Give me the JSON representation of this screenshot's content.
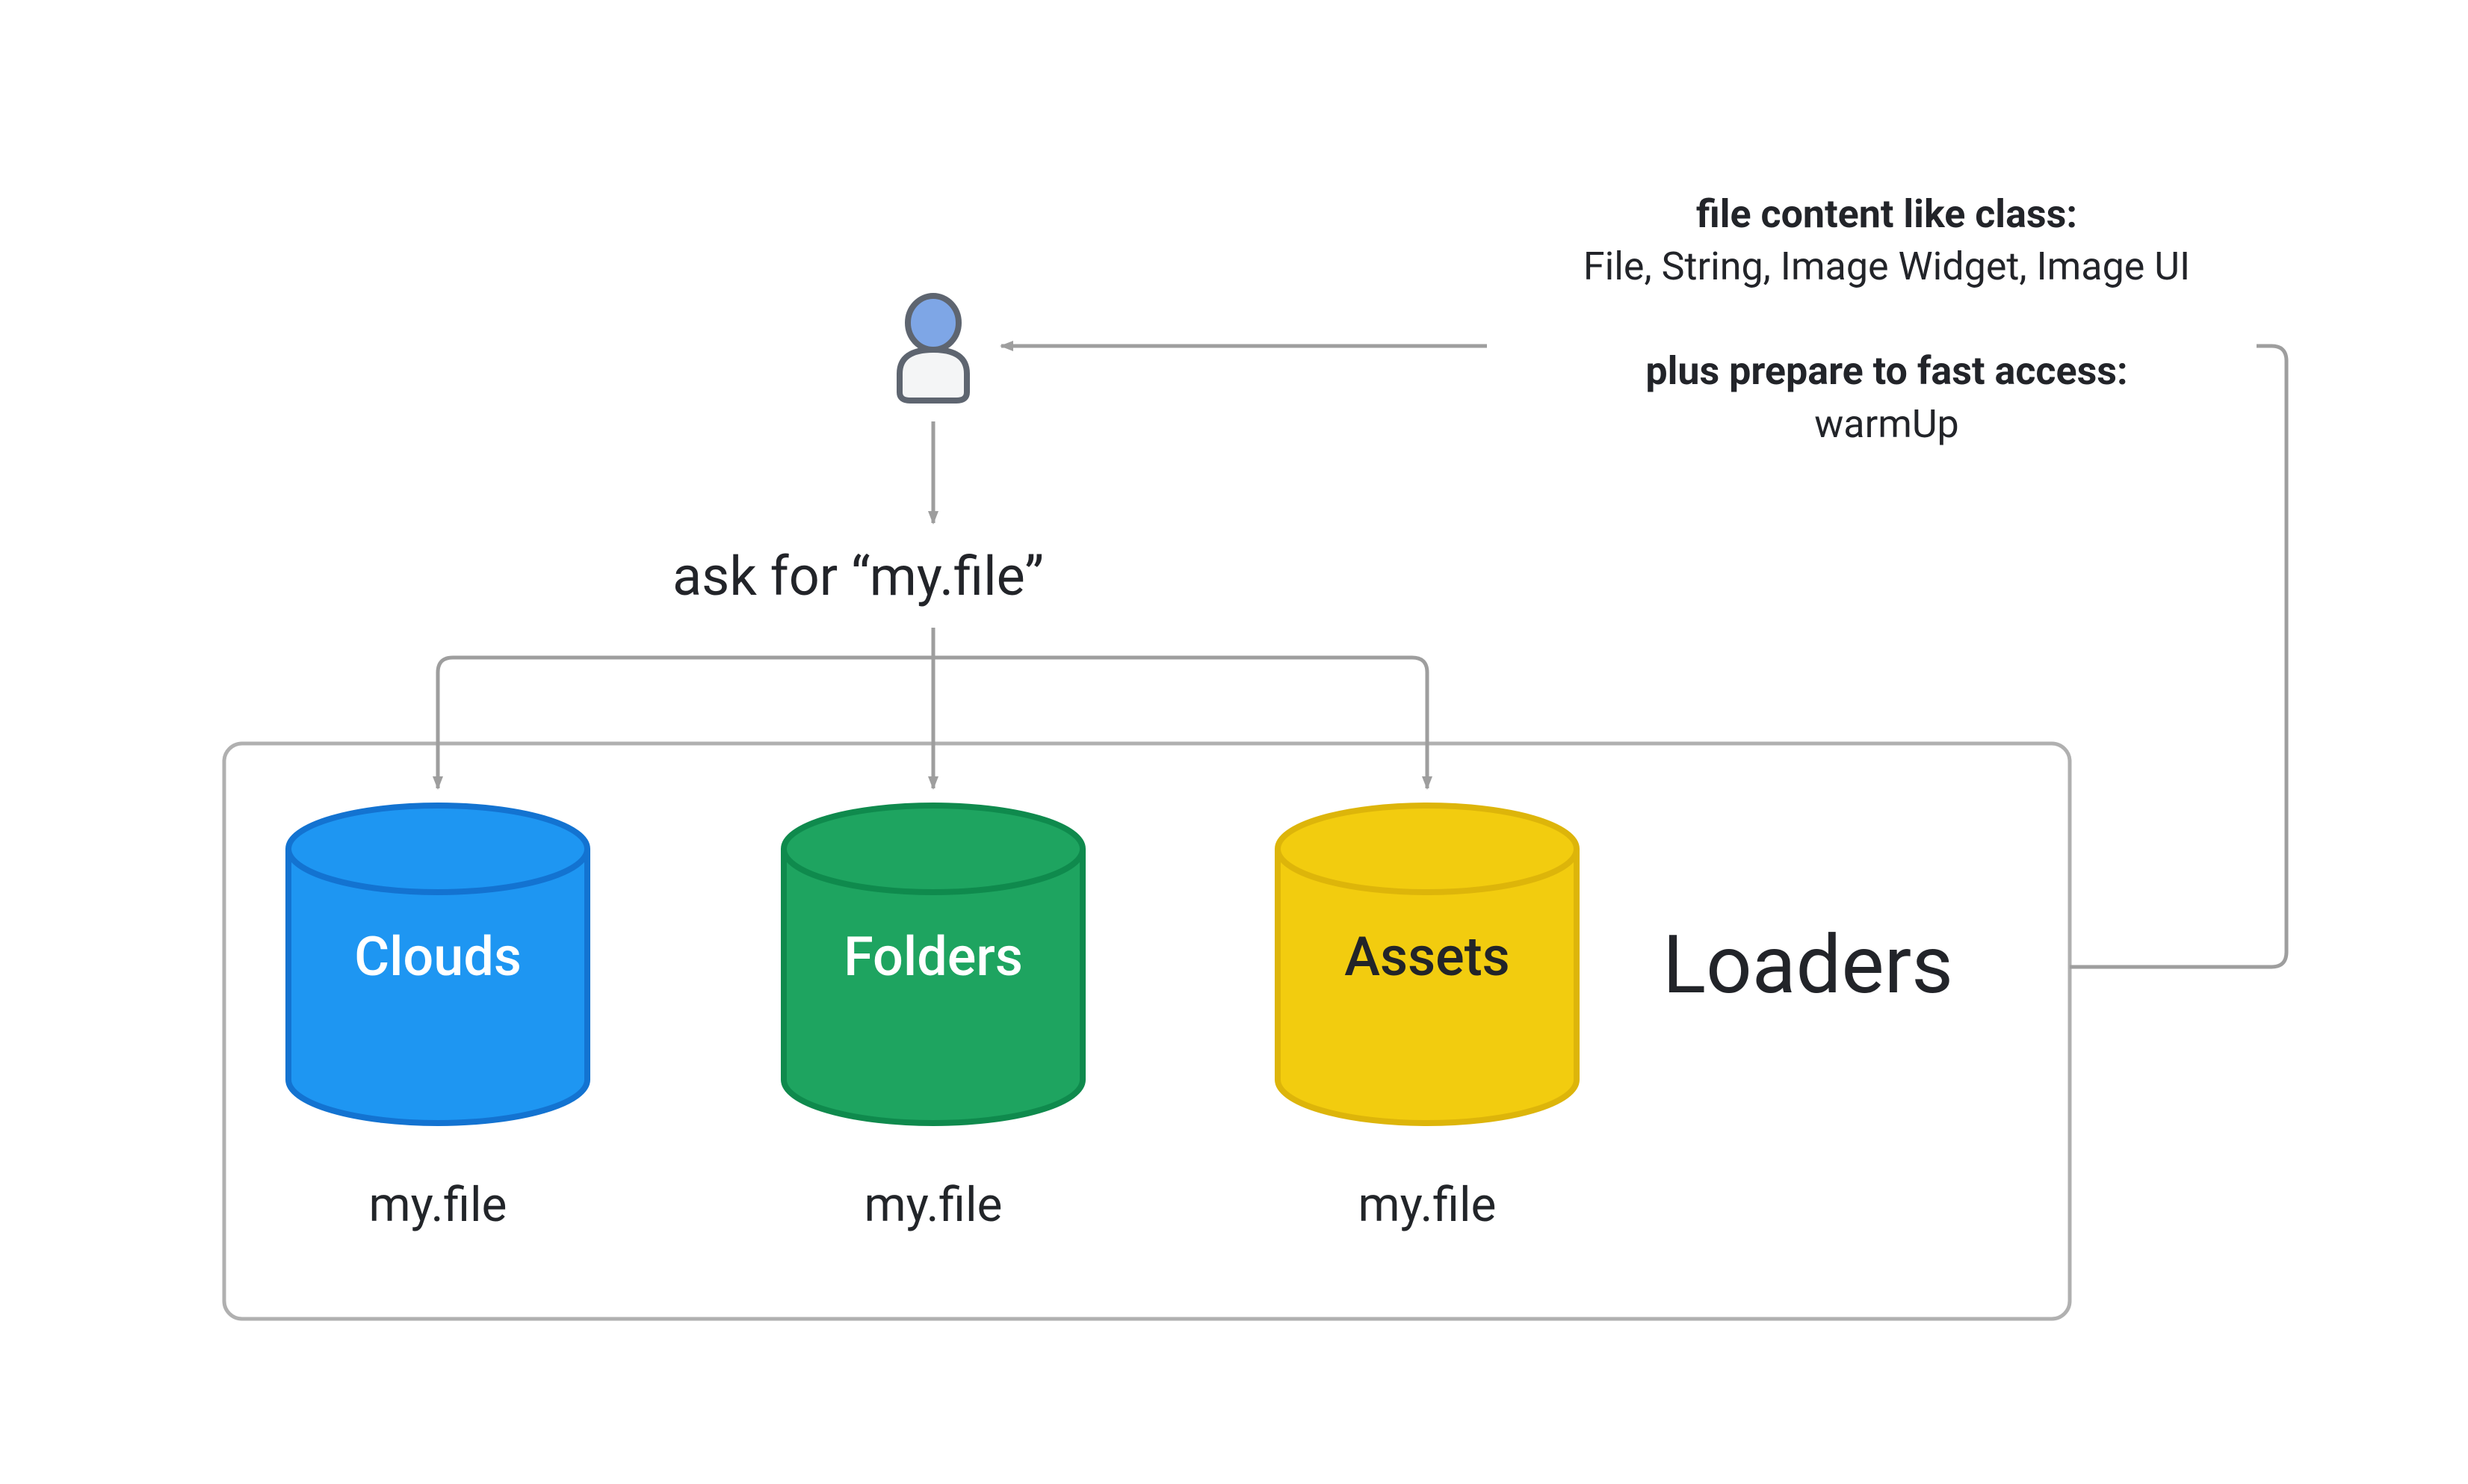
{
  "ask_label": "ask for “my.file”",
  "cylinders": {
    "clouds": {
      "label": "Clouds",
      "sublabel": "my.file"
    },
    "folders": {
      "label": "Folders",
      "sublabel": "my.file"
    },
    "assets": {
      "label": "Assets",
      "sublabel": "my.file"
    }
  },
  "loaders_label": "Loaders",
  "right_panel": {
    "heading1": "file content like class:",
    "line1": "File, String, Image Widget, Image UI",
    "heading2": "plus prepare to fast access:",
    "line2": "warmUp"
  },
  "colors": {
    "clouds_fill": "#1E96F2",
    "clouds_stroke": "#1373D1",
    "folders_fill": "#1EA460",
    "folders_stroke": "#0F8A4D",
    "assets_fill": "#F2CC0F",
    "assets_stroke": "#DDB50A",
    "box_stroke": "#B0B0B0",
    "arrow": "#9E9E9E",
    "person_head_fill": "#7EA6E6",
    "person_stroke": "#5E6570"
  }
}
